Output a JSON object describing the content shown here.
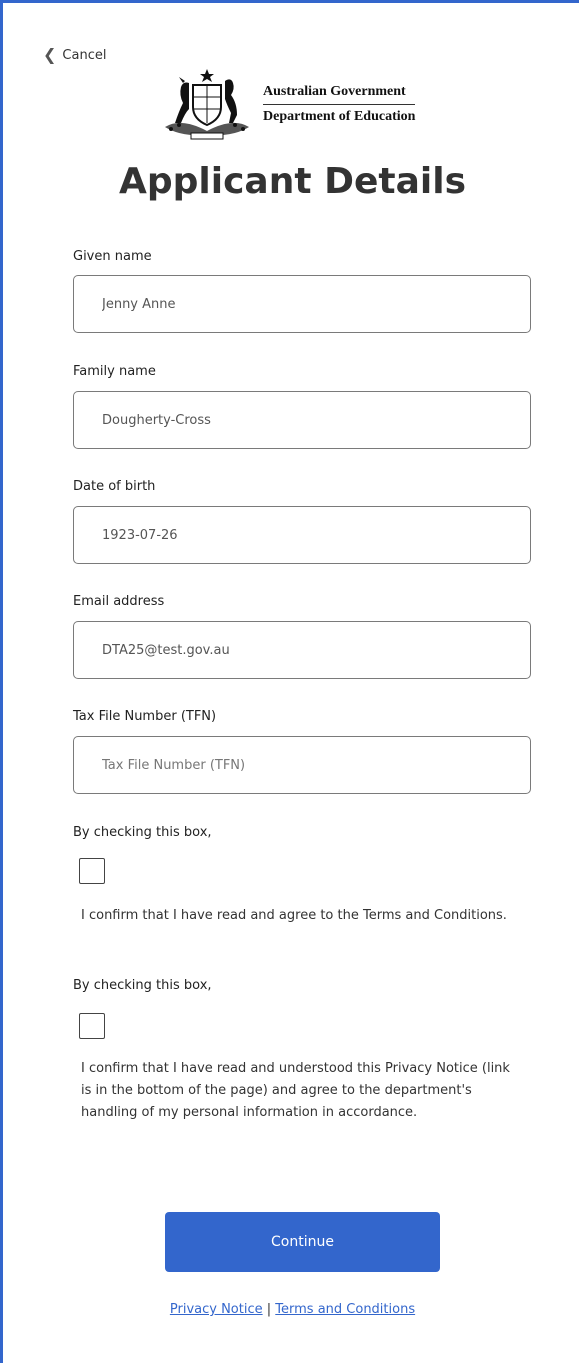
{
  "nav": {
    "cancel_label": "Cancel"
  },
  "branding": {
    "line1": "Australian Government",
    "line2": "Department of Education"
  },
  "page": {
    "title": "Applicant Details"
  },
  "form": {
    "given_name": {
      "label": "Given name",
      "value": "Jenny Anne",
      "placeholder": "Given name"
    },
    "family_name": {
      "label": "Family name",
      "value": "Dougherty-Cross",
      "placeholder": "Family name"
    },
    "dob": {
      "label": "Date of birth",
      "value": "1923-07-26",
      "placeholder": "Date of birth"
    },
    "email": {
      "label": "Email address",
      "value": "DTA25@test.gov.au",
      "placeholder": "Email address"
    },
    "tfn": {
      "label": "Tax File Number (TFN)",
      "value": "",
      "placeholder": "Tax File Number (TFN)"
    }
  },
  "consents": [
    {
      "heading": "By checking this box,",
      "text": "I confirm that I have read and agree to the Terms and Conditions.",
      "checked": false
    },
    {
      "heading": "By checking this box,",
      "text": "I confirm that I have read and understood this Privacy Notice (link is in the bottom of the page) and agree to the department's handling of my personal information in accordance.",
      "checked": false
    }
  ],
  "actions": {
    "continue_label": "Continue"
  },
  "footer": {
    "privacy_label": "Privacy Notice",
    "separator": "|",
    "terms_label": "Terms and Conditions"
  },
  "theme": {
    "accent": "#3366cc",
    "border": "#7a7a7a"
  }
}
